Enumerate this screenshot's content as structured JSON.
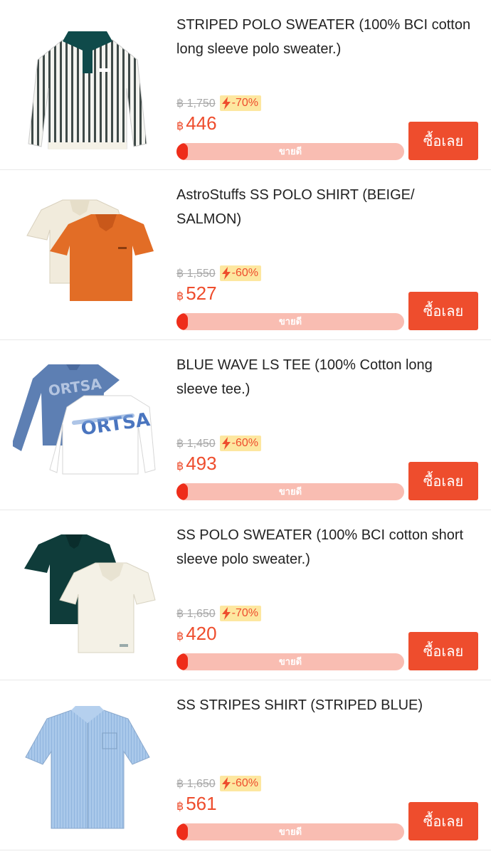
{
  "currency_symbol": "฿",
  "buy_label": "ซื้อเลย",
  "bar_label": "ขายดี",
  "colors": {
    "accent": "#ee4d2d",
    "bar_bg": "#f9bdb2",
    "bar_fill": "#ee2d1a",
    "discount_bg": "#fde7a0"
  },
  "products": [
    {
      "title": "STRIPED POLO SWEATER (100% BCI cotton long sleeve polo sweater.)",
      "old_price": "฿ 1,750",
      "discount": "-70%",
      "price": "446",
      "sold_fraction": 0.05
    },
    {
      "title": "AstroStuffs SS POLO SHIRT (BEIGE/ SALMON)",
      "old_price": "฿ 1,550",
      "discount": "-60%",
      "price": "527",
      "sold_fraction": 0.05
    },
    {
      "title": "BLUE WAVE LS TEE (100% Cotton long sleeve tee.)",
      "old_price": "฿ 1,450",
      "discount": "-60%",
      "price": "493",
      "sold_fraction": 0.05
    },
    {
      "title": "SS POLO SWEATER (100% BCI cotton short sleeve polo sweater.)",
      "old_price": "฿ 1,650",
      "discount": "-70%",
      "price": "420",
      "sold_fraction": 0.05
    },
    {
      "title": "SS STRIPES SHIRT (STRIPED BLUE)",
      "old_price": "฿ 1,650",
      "discount": "-60%",
      "price": "561",
      "sold_fraction": 0.05
    }
  ]
}
